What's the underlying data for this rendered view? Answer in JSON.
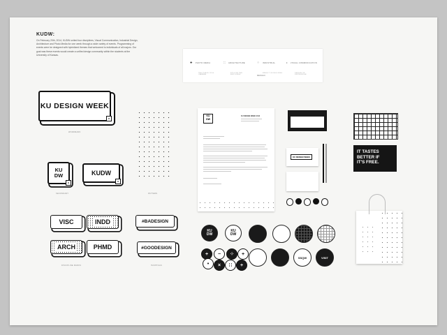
{
  "intro": {
    "title": "KUDW:",
    "body": "On February 20th, 2014, KUDW united four disciplines, Visual Communication, Industrial Design, Architecture and Photo Media for one week through a wide variety of events. Programming of events were be designed with hybridized themes that welcomed to individuals of all majors. Our goal was these events would create a unified design community within the students at the University of Kansas."
  },
  "disciplines": [
    {
      "icon": "✚",
      "label": "PHOTO MEDIA"
    },
    {
      "icon": "∷",
      "label": "ARCHITECTURE"
    },
    {
      "icon": "⁘",
      "label": "INDUSTRIAL DESIGN"
    },
    {
      "icon": "•",
      "label": "VISUAL COMMUNICATION"
    }
  ],
  "discipline_notes": [
    "THE PLACE OF A CAMERA",
    "FOLLOW THE BUILDINGS",
    "RESULT OF BUILDING",
    "DESIGN OF KNOWLEDGE"
  ],
  "logos": {
    "wordmark": "KU DESIGN WEEK",
    "stack_top": "KU",
    "stack_bottom": "DW",
    "short": "KUDW",
    "badge": "M"
  },
  "captions": {
    "wordmark": "WORDMARK",
    "secondary": "SECONDARY",
    "pattern": "PATTERN",
    "discipline_marks": "DISCIPLINE MARKS",
    "hashtags": "HASHTAGS"
  },
  "tags": [
    "VISC",
    "INDD",
    "ARCH",
    "PHMD"
  ],
  "hashtags": [
    "#BADESIGN",
    "#GOODESIGN"
  ],
  "letterhead": {
    "sender": "KU DESIGN WEEK 2014"
  },
  "card": {
    "wordmark": "KU DESIGN WEEK"
  },
  "promo": {
    "line1": "IT TASTES",
    "line2": "BETTER IF",
    "line3": "IT'S FREE."
  },
  "buttons": {
    "stack_top": "KU",
    "stack_bottom": "DW",
    "ssqw": "SSQW",
    "visit": "VISIT"
  }
}
